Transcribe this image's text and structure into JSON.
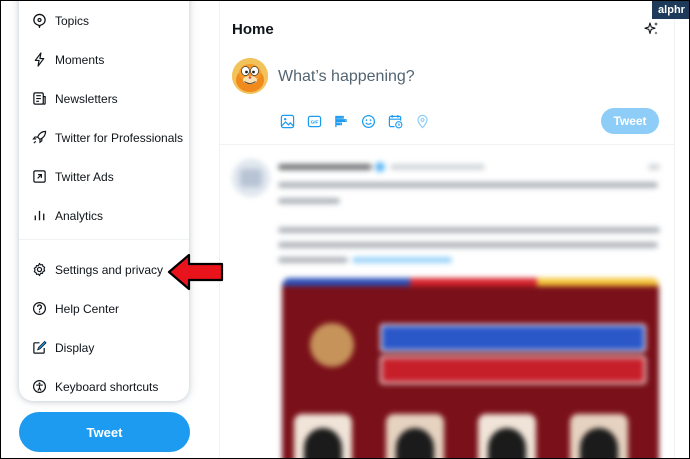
{
  "menu": {
    "items": [
      {
        "label": "Topics",
        "icon": "topics-icon"
      },
      {
        "label": "Moments",
        "icon": "moments-icon"
      },
      {
        "label": "Newsletters",
        "icon": "newsletters-icon"
      },
      {
        "label": "Twitter for Professionals",
        "icon": "rocket-icon"
      },
      {
        "label": "Twitter Ads",
        "icon": "ads-icon"
      },
      {
        "label": "Analytics",
        "icon": "analytics-icon"
      },
      {
        "label": "Settings and privacy",
        "icon": "gear-icon"
      },
      {
        "label": "Help Center",
        "icon": "help-icon"
      },
      {
        "label": "Display",
        "icon": "display-icon"
      },
      {
        "label": "Keyboard shortcuts",
        "icon": "accessibility-icon"
      }
    ],
    "tweet_button": "Tweet"
  },
  "main": {
    "title": "Home",
    "compose_placeholder": "What’s happening?",
    "tweet_button": "Tweet",
    "toolbar_icons": [
      "image-icon",
      "gif-icon",
      "poll-icon",
      "emoji-icon",
      "schedule-icon",
      "location-icon"
    ]
  },
  "watermark": "alphr",
  "colors": {
    "accent": "#1d9bf0",
    "accent_disabled": "#8ecdf8",
    "text": "#0f1419",
    "arrow": "#e8131b"
  }
}
